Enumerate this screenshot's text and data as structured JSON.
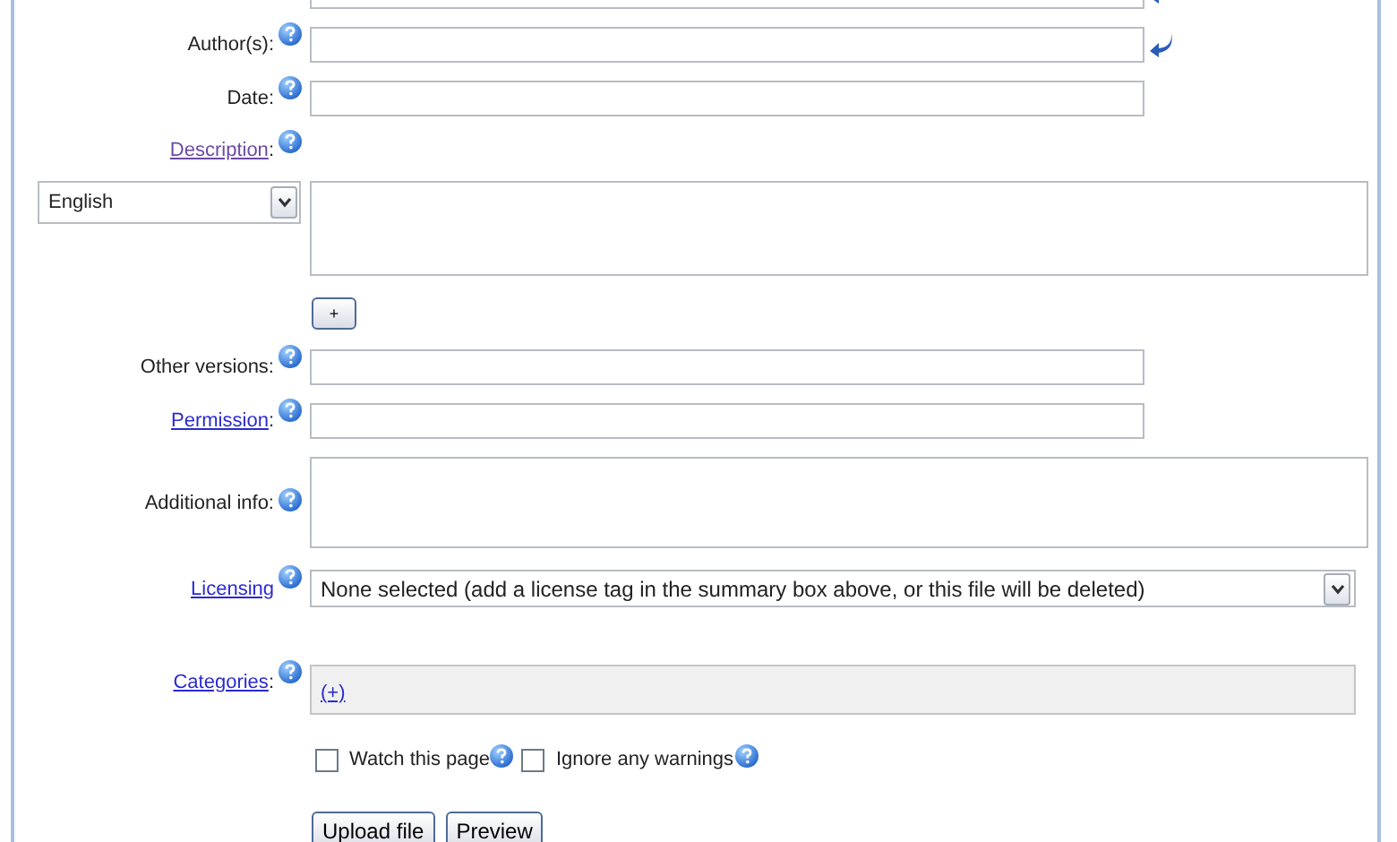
{
  "rows": [
    {
      "kind": "text",
      "return_icon": true
    },
    {
      "kind": "text",
      "label": "Author(s):",
      "help": true,
      "return_icon": true
    },
    {
      "kind": "text",
      "label": "Date:",
      "help": true,
      "return_icon": false
    },
    {
      "kind": "heading",
      "link": "Description",
      "visited": true,
      "suffix": ":",
      "help": true
    },
    {
      "kind": "multilingual",
      "language": "English"
    },
    {
      "kind": "add",
      "button": "+"
    },
    {
      "kind": "text",
      "label": "Other versions:",
      "help": true,
      "return_icon": false
    },
    {
      "kind": "text",
      "link": "Permission",
      "visited": false,
      "suffix": ":",
      "help": true,
      "return_icon": false
    },
    {
      "kind": "textarea",
      "label": "Additional info:",
      "help": true
    },
    {
      "kind": "select",
      "link": "Licensing",
      "visited": false,
      "help": true,
      "value": "None selected (add a license tag in the summary box above, or this file will be deleted)"
    },
    {
      "kind": "categories",
      "link": "Categories",
      "visited": false,
      "suffix": ":",
      "help": true,
      "add_link": "(+)"
    },
    {
      "kind": "checkboxes",
      "items": [
        {
          "label": "Watch this page",
          "checked": false,
          "help": true
        },
        {
          "label": "Ignore any warnings",
          "checked": false,
          "help": true
        }
      ]
    },
    {
      "kind": "buttons",
      "items": [
        "Upload file",
        "Preview"
      ]
    }
  ]
}
